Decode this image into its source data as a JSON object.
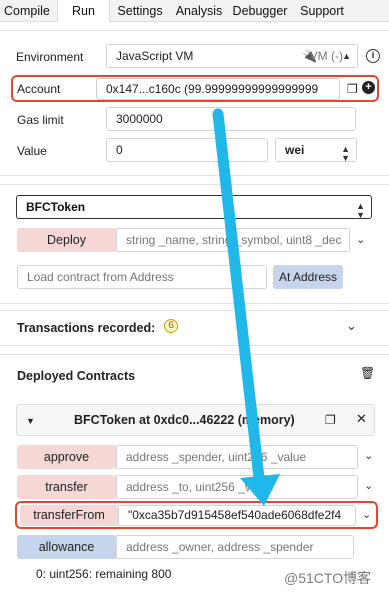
{
  "tabs": [
    "Compile",
    "Run",
    "Settings",
    "Analysis",
    "Debugger",
    "Support"
  ],
  "env": {
    "environment_label": "Environment",
    "environment_value": "JavaScript VM",
    "vm_text": "VM (-)",
    "account_label": "Account",
    "account_value": "0x147...c160c (99.99999999999999999",
    "gas_label": "Gas limit",
    "gas_value": "3000000",
    "value_label": "Value",
    "value_value": "0",
    "unit": "wei"
  },
  "deploy": {
    "contract_select": "BFCToken",
    "deploy_label": "Deploy",
    "deploy_args_placeholder": "string _name, string _symbol, uint8 _dec",
    "load_placeholder": "Load contract from Address",
    "at_address_label": "At Address"
  },
  "transactions": {
    "label": "Transactions recorded:",
    "count": "6"
  },
  "deployed": {
    "header": "Deployed Contracts",
    "instance_title": "BFCToken at 0xdc0...46222 (memory)",
    "functions": [
      {
        "name": "approve",
        "args": "address _spender, uint256 _value"
      },
      {
        "name": "transfer",
        "args": "address _to, uint256 _value"
      },
      {
        "name": "transferFrom",
        "args": "\"0xca35b7d915458ef540ade6068dfe2f4"
      },
      {
        "name": "allowance",
        "args": "address _owner, address _spender"
      }
    ],
    "result": "0: uint256: remaining 800"
  },
  "watermark": "@51CTO博客",
  "colors": {
    "accent_red": "#e8452c",
    "arrow": "#1fb8e8",
    "transact_btn": "#f5d7d6",
    "call_btn": "#c7d5ec"
  }
}
